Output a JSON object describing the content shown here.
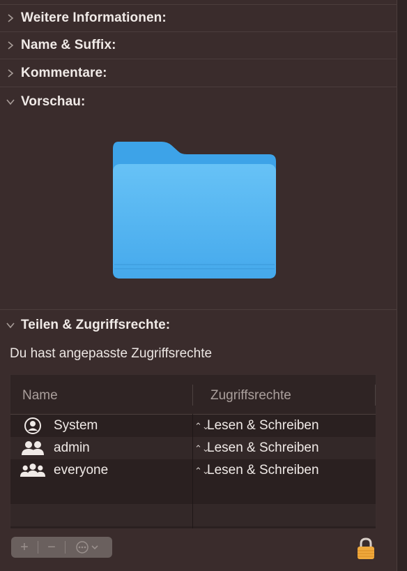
{
  "sections": [
    {
      "label": "Weitere Informationen:",
      "expanded": false
    },
    {
      "label": "Name & Suffix:",
      "expanded": false
    },
    {
      "label": "Kommentare:",
      "expanded": false
    },
    {
      "label": "Vorschau:",
      "expanded": true
    },
    {
      "label": "Teilen & Zugriffsrechte:",
      "expanded": true
    }
  ],
  "sharing": {
    "info": "Du hast angepasste Zugriffsrechte",
    "columns": {
      "name": "Name",
      "permission": "Zugriffsrechte"
    },
    "rows": [
      {
        "icon": "user-circle-icon",
        "name": "System",
        "permission": "Lesen & Schreiben"
      },
      {
        "icon": "group-icon",
        "name": "admin",
        "permission": "Lesen & Schreiben"
      },
      {
        "icon": "everyone-icon",
        "name": "everyone",
        "permission": "Lesen & Schreiben"
      }
    ],
    "toolbar": {
      "add": "+",
      "remove": "−"
    }
  },
  "colors": {
    "folder": "#5cb8f2",
    "folder_tab": "#3ea4e8",
    "lock": "#f0a93c",
    "background": "#3a2c2c"
  }
}
